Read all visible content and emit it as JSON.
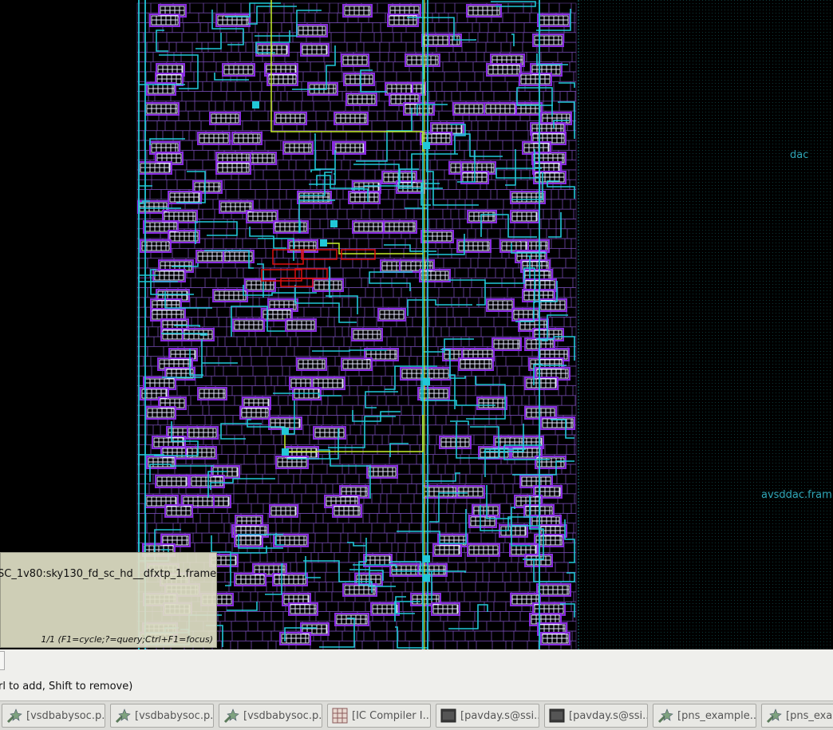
{
  "layout_view": {
    "macro_labels": {
      "dac": "dac",
      "frame": "avsddac.fram"
    },
    "colors": {
      "background": "#000000",
      "cell_outline": "#7a4fb8",
      "pin_box": "#e6e6ff",
      "route_cyan": "#21c8d8",
      "route_yellow": "#c8f02a",
      "highlight": "#e01010",
      "boundary_dots": "#0c3a3a"
    }
  },
  "tooltip": {
    "cell_name": "SC_1v80:sky130_fd_sc_hd__dfxtp_1.frame",
    "help": "1/1 (F1=cycle;?=query;Ctrl+F1=focus)"
  },
  "statusbar": {
    "hint": "rl to add, Shift to remove)"
  },
  "taskbar": {
    "items": [
      {
        "label": "[vsdbabysoc.p...",
        "icon": "magic-icon"
      },
      {
        "label": "[vsdbabysoc.p...",
        "icon": "magic-icon"
      },
      {
        "label": "[vsdbabysoc.p...",
        "icon": "magic-icon"
      },
      {
        "label": "[IC Compiler I...",
        "icon": "grid-icon"
      },
      {
        "label": "[pavday.s@ssi...",
        "icon": "terminal-icon"
      },
      {
        "label": "[pavday.s@ssi...",
        "icon": "terminal-icon"
      },
      {
        "label": "[pns_example...",
        "icon": "magic-icon"
      },
      {
        "label": "[pns_exam...",
        "icon": "magic-icon"
      }
    ]
  }
}
